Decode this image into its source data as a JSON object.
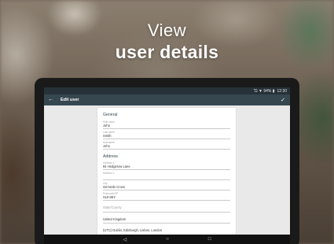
{
  "promo": {
    "line1": "View",
    "line2": "user details"
  },
  "status_bar": {
    "icons": "Ὤ ▼ 94% ▮",
    "time": "12:30"
  },
  "app_bar": {
    "back_icon": "arrow-back-icon",
    "title": "Edit user",
    "save_icon": "checkmark-icon"
  },
  "form": {
    "general": {
      "title": "General",
      "first_name": {
        "label": "First name",
        "value": "John"
      },
      "last_name": {
        "label": "Last name",
        "value": "Smith"
      },
      "username": {
        "label": "Username",
        "value": "John"
      }
    },
    "address": {
      "title": "Address",
      "address1": {
        "label": "Address 1",
        "value": "94 Hedgerow Lane"
      },
      "address2": {
        "label": "Address 2",
        "placeholder": ""
      },
      "city": {
        "label": "City",
        "value": "Gerrards Cross"
      },
      "postcode": {
        "label": "Postcode/ZIP",
        "value": "SL9 8EY"
      },
      "state": {
        "placeholder": "State/County"
      },
      "country": {
        "value": "United Kingdom"
      },
      "timezone": {
        "value": "(UTC) Dublin, Edinburgh, Lisbon, London"
      }
    }
  },
  "nav_bar": {
    "back": "◁",
    "home": "○",
    "recents": "□"
  },
  "colors": {
    "appbar": "#37474f",
    "statusbar": "#263238",
    "screen_bg": "#e9e9e9"
  }
}
